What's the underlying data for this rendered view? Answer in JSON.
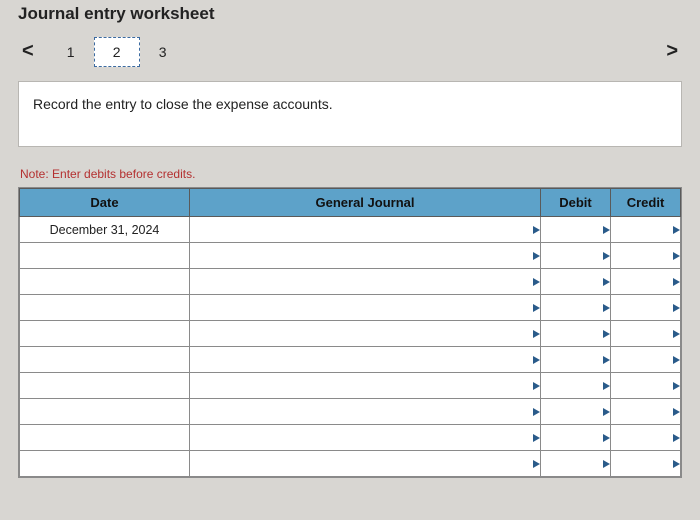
{
  "title": "Journal entry worksheet",
  "nav": {
    "prev": "<",
    "next": ">"
  },
  "tabs": [
    "1",
    "2",
    "3"
  ],
  "active_tab_index": 1,
  "instruction": "Record the entry to close the expense accounts.",
  "note": "Note: Enter debits before credits.",
  "columns": {
    "date": "Date",
    "general_journal": "General Journal",
    "debit": "Debit",
    "credit": "Credit"
  },
  "rows": [
    {
      "date": "December 31, 2024",
      "general_journal": "",
      "debit": "",
      "credit": ""
    },
    {
      "date": "",
      "general_journal": "",
      "debit": "",
      "credit": ""
    },
    {
      "date": "",
      "general_journal": "",
      "debit": "",
      "credit": ""
    },
    {
      "date": "",
      "general_journal": "",
      "debit": "",
      "credit": ""
    },
    {
      "date": "",
      "general_journal": "",
      "debit": "",
      "credit": ""
    },
    {
      "date": "",
      "general_journal": "",
      "debit": "",
      "credit": ""
    },
    {
      "date": "",
      "general_journal": "",
      "debit": "",
      "credit": ""
    },
    {
      "date": "",
      "general_journal": "",
      "debit": "",
      "credit": ""
    },
    {
      "date": "",
      "general_journal": "",
      "debit": "",
      "credit": ""
    },
    {
      "date": "",
      "general_journal": "",
      "debit": "",
      "credit": ""
    }
  ],
  "colors": {
    "header_bg": "#5da2c9",
    "note_color": "#b43030"
  }
}
